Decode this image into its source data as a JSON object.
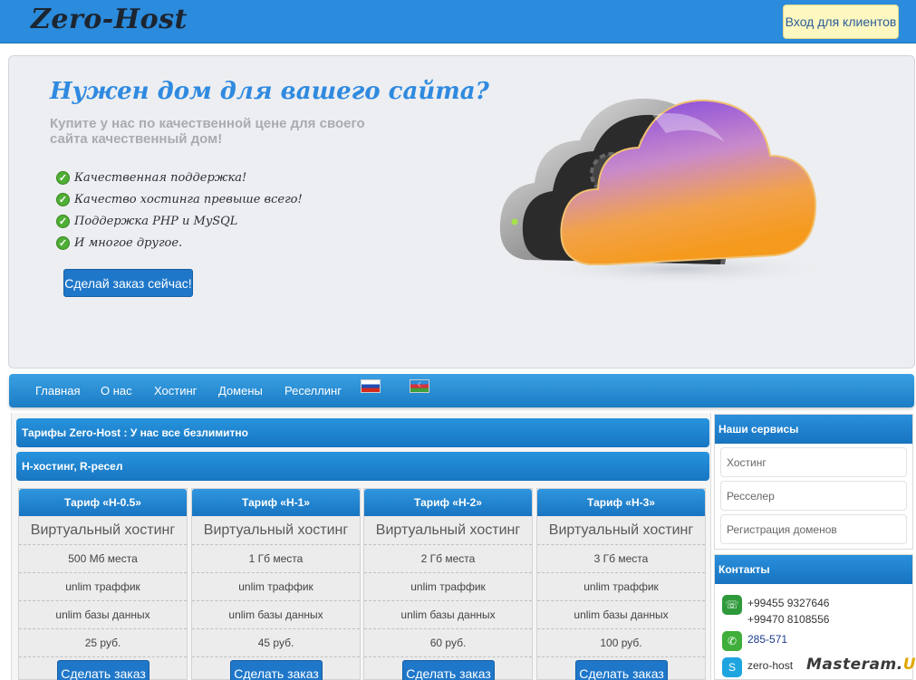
{
  "header": {
    "logo": "Zero-Host",
    "client_login": "Вход для клиентов"
  },
  "hero": {
    "title": "Нужен дом для вашего сайта?",
    "subtitle": "Купите у нас по качественной цене для своего сайта качественный дом!",
    "features": [
      "Качественная поддержка!",
      "Качество хостинга превыше всего!",
      "Поддержка PHP и MySQL",
      "И многое другое."
    ],
    "cta": "Сделай заказ сейчас!"
  },
  "nav": {
    "items": [
      "Главная",
      "О нас",
      "Хостинг",
      "Домены",
      "Реселлинг"
    ],
    "flags": [
      "flag-russia-icon",
      "flag-azerbaijan-icon"
    ]
  },
  "main": {
    "bar1": "Тарифы Zero-Host : У нас все безлимитно",
    "bar2": "H-хостинг, R-ресел",
    "plans": [
      {
        "name": "Тариф «H-0.5»",
        "type": "Виртуальный хостинг",
        "space": "500 Мб места",
        "traffic": "unlim траффик",
        "db": "unlim базы данных",
        "price": "25 руб.",
        "button": "Сделать заказ"
      },
      {
        "name": "Тариф «H-1»",
        "type": "Виртуальный хостинг",
        "space": "1 Гб места",
        "traffic": "unlim траффик",
        "db": "unlim базы данных",
        "price": "45 руб.",
        "button": "Сделать заказ"
      },
      {
        "name": "Тариф «H-2»",
        "type": "Виртуальный хостинг",
        "space": "2 Гб места",
        "traffic": "unlim траффик",
        "db": "unlim базы данных",
        "price": "60 руб.",
        "button": "Сделать заказ"
      },
      {
        "name": "Тариф «H-3»",
        "type": "Виртуальный хостинг",
        "space": "3 Гб места",
        "traffic": "unlim траффик",
        "db": "unlim базы данных",
        "price": "100 руб.",
        "button": "Сделать заказ"
      }
    ]
  },
  "sidebar": {
    "services_title": "Наши сервисы",
    "services": [
      "Хостинг",
      "Ресселер",
      "Регистрация доменов"
    ],
    "contacts_title": "Контакты",
    "phone1": "+99455 9327646",
    "phone2": "+99470 8108556",
    "whatsapp": "285-571",
    "skype": "zero-host"
  },
  "watermark": {
    "main": "Masteram.",
    "suffix": "US"
  },
  "colors": {
    "brand_blue": "#2b8bdc",
    "button_blue": "#1f77c9",
    "hero_title": "#2f8ae0",
    "client_btn": "#fdf7c0"
  }
}
